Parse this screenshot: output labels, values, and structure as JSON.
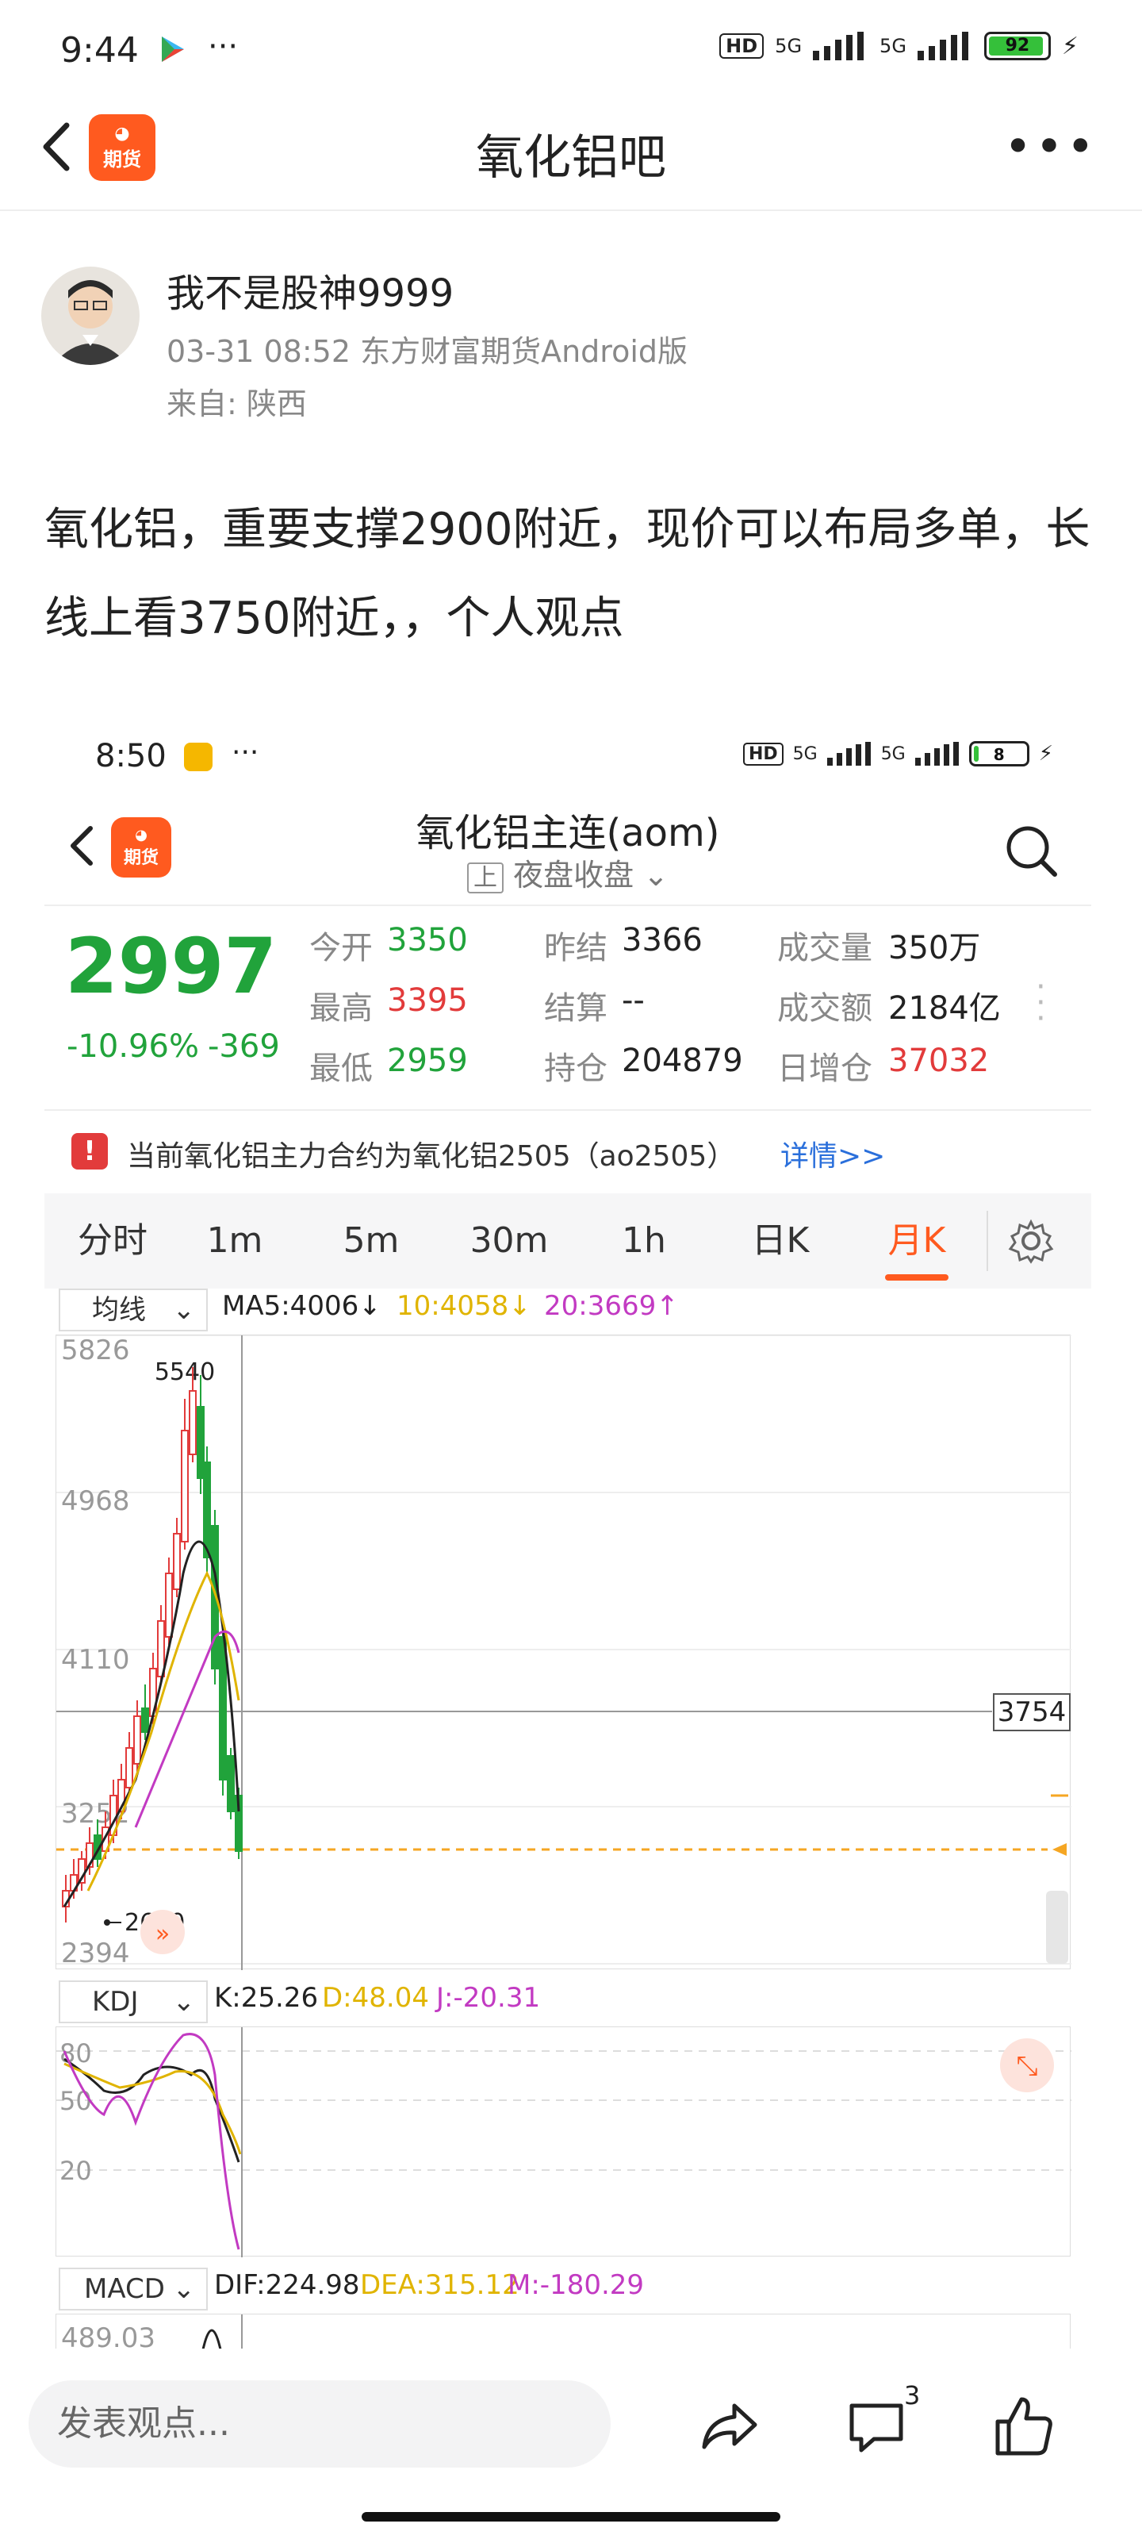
{
  "statusbar": {
    "time": "9:44",
    "network": "5G",
    "battery": "92"
  },
  "nav": {
    "title": "氧化铝吧"
  },
  "post": {
    "author": "我不是股神9999",
    "meta": "03-31 08:52 东方财富期货Android版",
    "from": "来自: 陕西",
    "body": "氧化铝，重要支撑2900附近，现价可以布局多单，长线上看3750附近，，个人观点"
  },
  "shot": {
    "statusbar": {
      "time": "8:50",
      "battery": "8"
    },
    "header": {
      "title": "氧化铝主连(aom)",
      "sub_badge": "上",
      "subtitle": "夜盘收盘"
    },
    "quote": {
      "price": "2997",
      "change_pct": "-10.96%",
      "change": "-369",
      "rows": [
        [
          {
            "l": "今开",
            "v": "3350",
            "c": "green"
          },
          {
            "l": "昨结",
            "v": "3366",
            "c": ""
          },
          {
            "l": "成交量",
            "v": "350万",
            "c": ""
          }
        ],
        [
          {
            "l": "最高",
            "v": "3395",
            "c": "red"
          },
          {
            "l": "结算",
            "v": "--",
            "c": ""
          },
          {
            "l": "成交额",
            "v": "2184亿",
            "c": ""
          }
        ],
        [
          {
            "l": "最低",
            "v": "2959",
            "c": "green"
          },
          {
            "l": "持仓",
            "v": "204879",
            "c": ""
          },
          {
            "l": "日增仓",
            "v": "37032",
            "c": "red"
          }
        ]
      ]
    },
    "notice": {
      "text": "当前氧化铝主力合约为氧化铝2505（ao2505）",
      "link": "详情>>"
    },
    "tabs": [
      "分时",
      "1m",
      "5m",
      "30m",
      "1h",
      "日K",
      "月K"
    ],
    "active_tab": "月K",
    "ma": {
      "selector": "均线",
      "ma5": "MA5:4006↓",
      "ma10": "10:4058↓",
      "ma20": "20:3669↑"
    },
    "kline_axis": [
      "5826",
      "4968",
      "4110",
      "3252",
      "2394"
    ],
    "kline_labels": {
      "high": "5540",
      "low": "2680",
      "crosshair": "3754"
    },
    "kdj": {
      "selector": "KDJ",
      "k": "K:25.26",
      "d": "D:48.04",
      "j": "J:-20.31",
      "axis": [
        "80",
        "50",
        "20"
      ]
    },
    "macd": {
      "selector": "MACD",
      "dif": "DIF:224.98",
      "dea": "DEA:315.12",
      "m": "M:-180.29",
      "axis_top": "489.03"
    }
  },
  "bottom": {
    "placeholder": "发表观点...",
    "comment_count": "3"
  },
  "colors": {
    "green": "#21a33b",
    "red": "#e23b3b",
    "orange": "#ff5a1f",
    "ma10": "#e0b400",
    "ma20": "#c23ac2"
  }
}
